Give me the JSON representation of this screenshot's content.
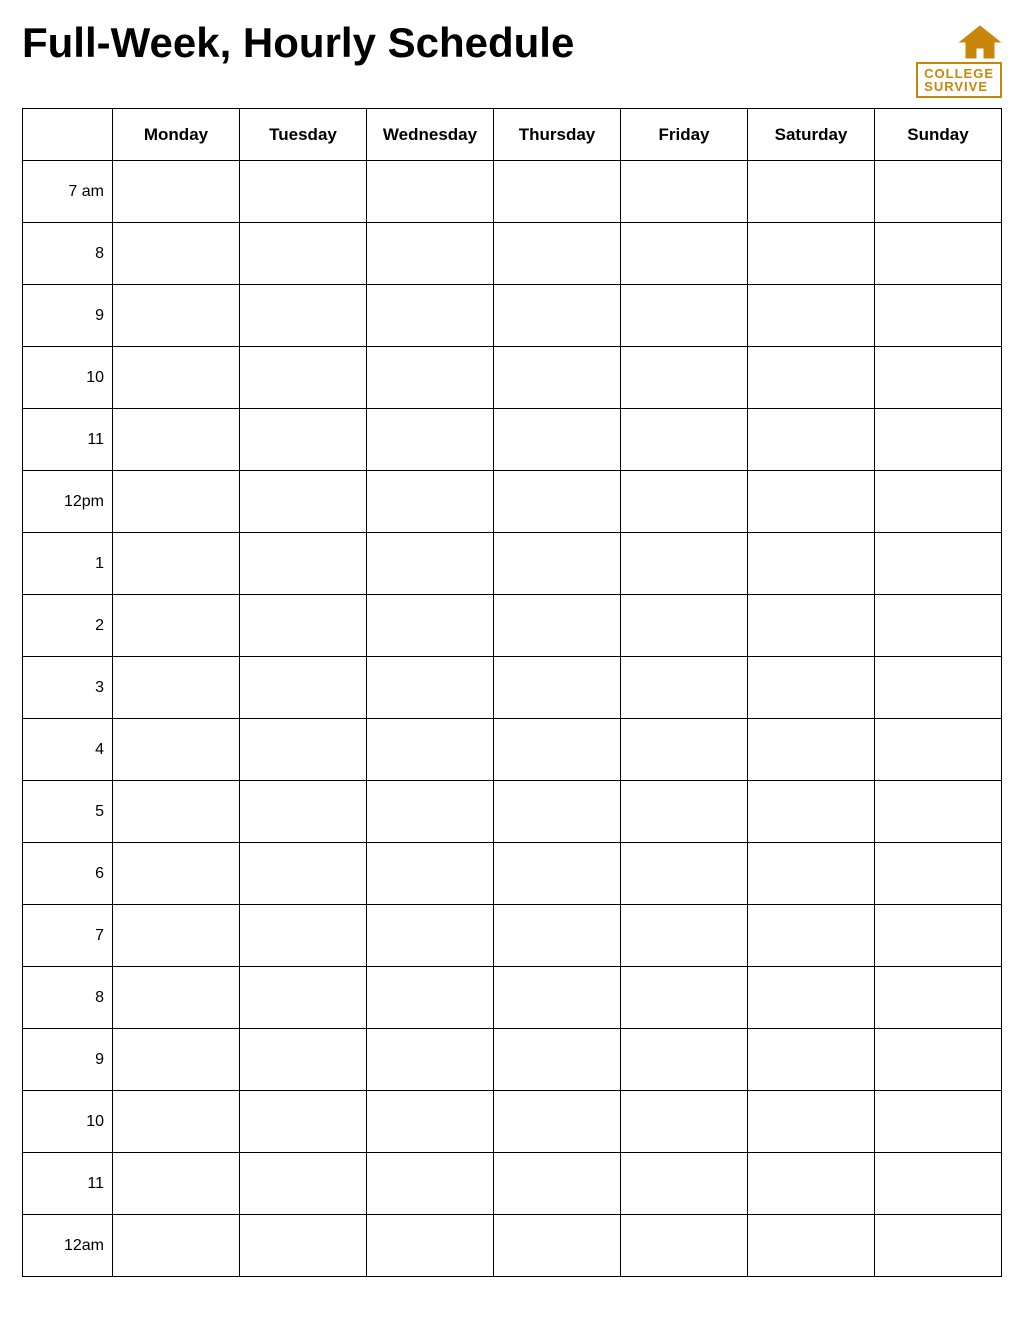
{
  "header": {
    "title": "Full-Week, Hourly Schedule",
    "logo": {
      "line1": "COLLEGE",
      "line2": "SURVIVE"
    }
  },
  "table": {
    "time_header": "",
    "days": [
      "Monday",
      "Tuesday",
      "Wednesday",
      "Thursday",
      "Friday",
      "Saturday",
      "Sunday"
    ],
    "times": [
      "7 am",
      "8",
      "9",
      "10",
      "11",
      "12pm",
      "1",
      "2",
      "3",
      "4",
      "5",
      "6",
      "7",
      "8",
      "9",
      "10",
      "11",
      "12am"
    ]
  }
}
